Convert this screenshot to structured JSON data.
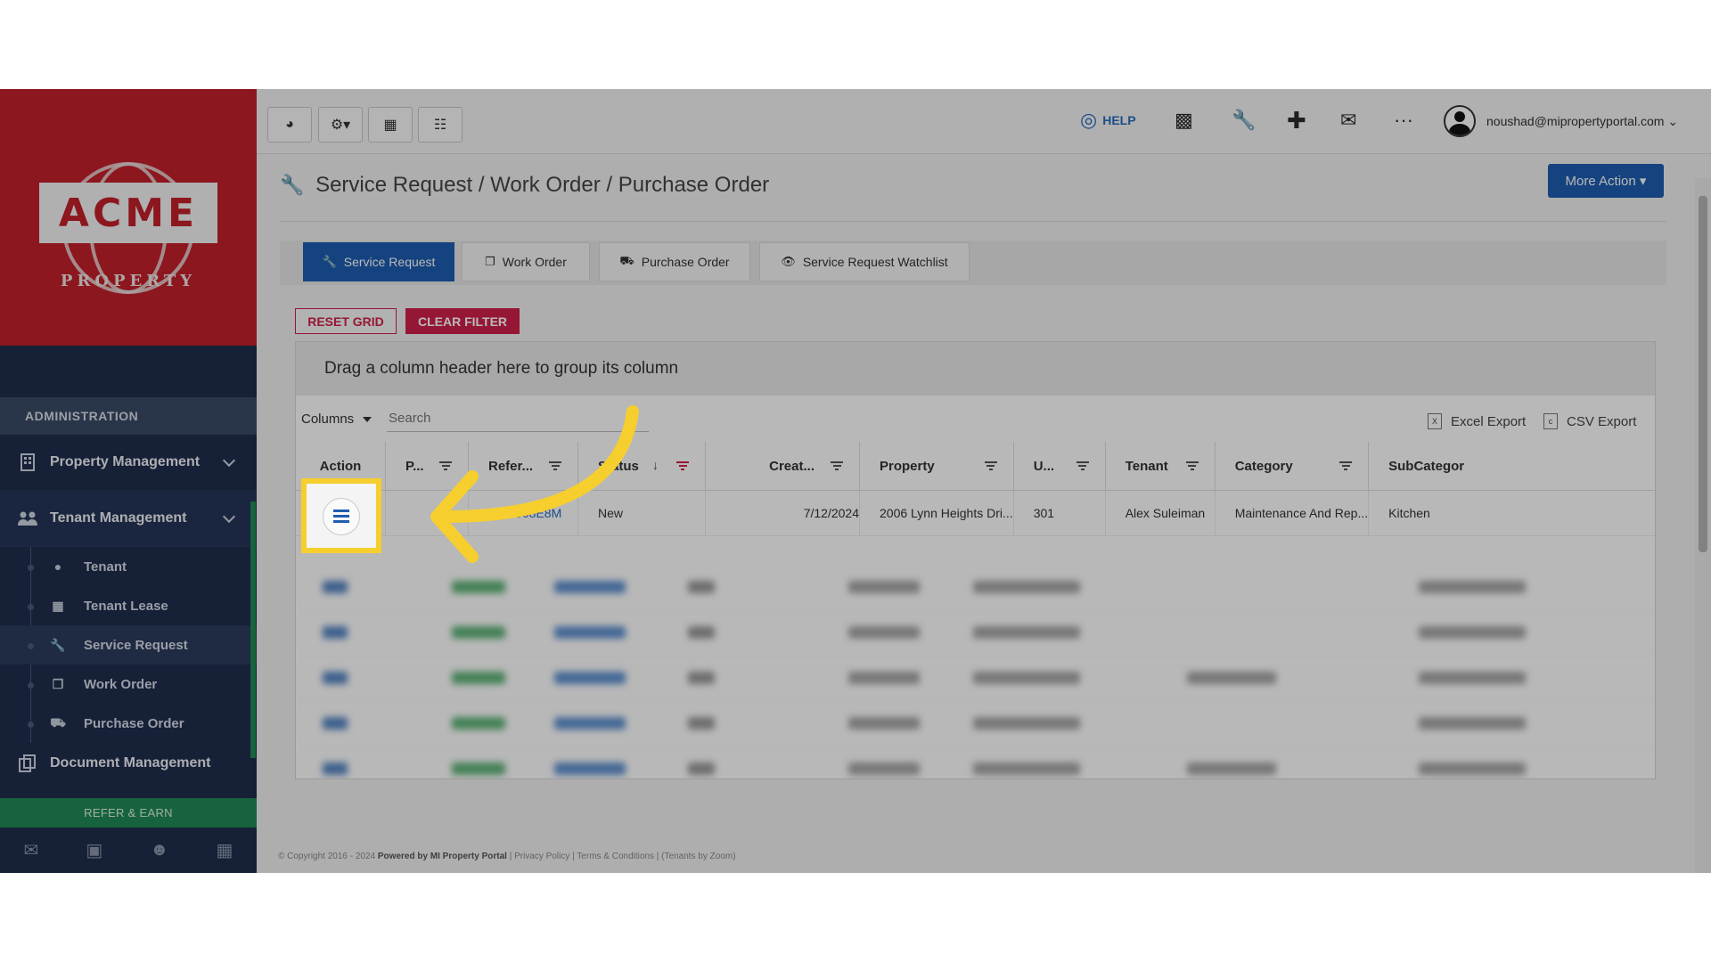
{
  "sidebar": {
    "logo_text": "ACME",
    "logo_sub": "PROPERTY",
    "section": "ADMINISTRATION",
    "items": [
      {
        "label": "Property Management"
      },
      {
        "label": "Tenant Management"
      }
    ],
    "subitems": [
      {
        "label": "Tenant",
        "icon": "user-icon"
      },
      {
        "label": "Tenant Lease",
        "icon": "calendar-check-icon"
      },
      {
        "label": "Service Request",
        "icon": "wrench-icon"
      },
      {
        "label": "Work Order",
        "icon": "copy-icon"
      },
      {
        "label": "Purchase Order",
        "icon": "truck-icon"
      }
    ],
    "doc_mgmt": "Document Management",
    "refer": "REFER & EARN"
  },
  "topbar": {
    "help": "HELP",
    "user_email": "noushad@mipropertyportal.com"
  },
  "page": {
    "title": "Service Request / Work Order / Purchase Order",
    "more_action": "More Action",
    "tabs": [
      {
        "label": "Service Request",
        "active": true
      },
      {
        "label": "Work Order"
      },
      {
        "label": "Purchase Order"
      },
      {
        "label": "Service Request Watchlist"
      }
    ],
    "reset_grid": "RESET GRID",
    "clear_filter": "CLEAR FILTER"
  },
  "grid": {
    "group_hint": "Drag a column header here to group its column",
    "columns_btn": "Columns",
    "search_placeholder": "Search",
    "excel_export": "Excel Export",
    "csv_export": "CSV Export",
    "headers": [
      "Action",
      "P...",
      "Refer...",
      "Status",
      "Creat...",
      "Property",
      "U...",
      "Tenant",
      "Category",
      "SubCategor"
    ],
    "first_row": {
      "reference": "1130008E8M",
      "status": "New",
      "created": "7/12/2024",
      "property": "2006 Lynn Heights Dri...",
      "unit": "301",
      "tenant": "Alex Suleiman",
      "category": "Maintenance And Rep...",
      "subcategory": "Kitchen"
    }
  },
  "footer": {
    "copyright": "© Copyright 2016 - 2024",
    "powered": "Powered by MI Property Portal",
    "links": "| Privacy Policy | Terms & Conditions",
    "tenants": "| (Tenants by Zoom)"
  },
  "colors": {
    "brand_red": "#c4202b",
    "primary_blue": "#1e5db0",
    "danger": "#d0204a",
    "sidebar_bg": "#1f2d4d",
    "highlight": "#f6cf2e"
  }
}
